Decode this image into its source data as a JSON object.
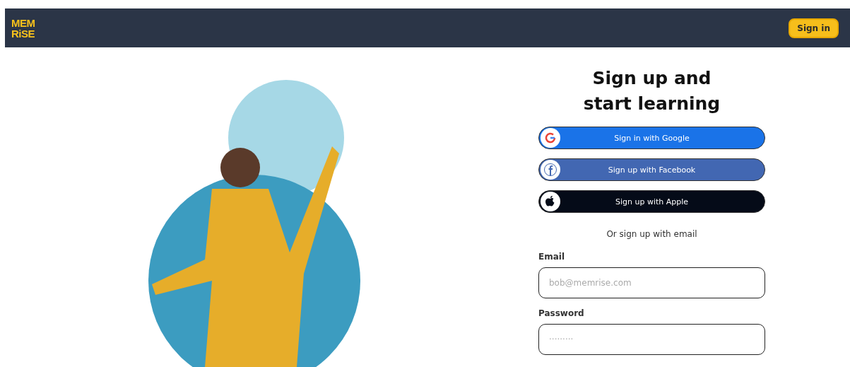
{
  "header": {
    "logo": [
      "MEM",
      "RiSE"
    ],
    "sign_in_button": "Sign in"
  },
  "form": {
    "title": "Sign up and start learning",
    "social_buttons": [
      {
        "kind": "google",
        "label": "Sign in with Google"
      },
      {
        "kind": "facebook",
        "label": "Sign up with Facebook"
      },
      {
        "kind": "apple",
        "label": "Sign up with Apple"
      }
    ],
    "divider_text": "Or sign up with email",
    "fields": [
      {
        "label": "Email",
        "placeholder": "bob@memrise.com"
      },
      {
        "label": "Password",
        "placeholder": "·········"
      }
    ]
  }
}
